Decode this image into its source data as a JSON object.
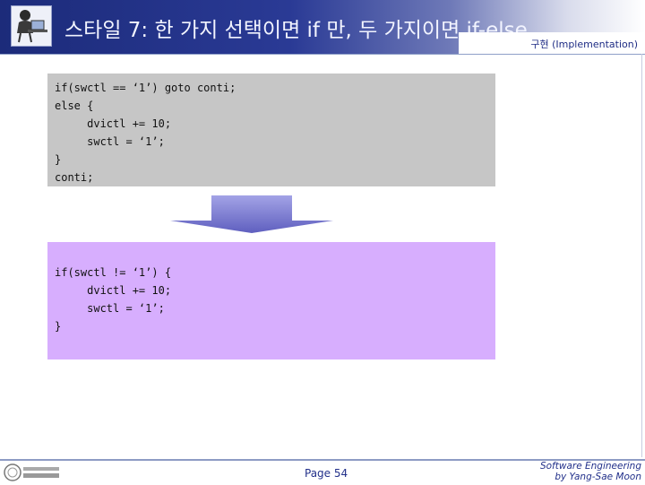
{
  "header": {
    "title": "스타일 7: 한 가지 선택이면 if 만, 두 가지이면 if-else",
    "subtitle": "구현 (Implementation)"
  },
  "code_before": [
    "if(swctl == ‘1’) goto conti;",
    "else {",
    "     dvictl += 10;",
    "     swctl = ‘1’;",
    "}",
    "conti;"
  ],
  "code_after": [
    "if(swctl != ‘1’) {",
    "     dvictl += 10;",
    "     swctl = ‘1’;",
    "}"
  ],
  "footer": {
    "page": "Page 54",
    "credit_line1": "Software Engineering",
    "credit_line2": "by Yang-Sae Moon"
  },
  "colors": {
    "header_blue": "#1c2b7a",
    "code_before_bg": "#c6c6c6",
    "code_after_bg": "#d7aefe",
    "arrow": "#8a8ad6"
  },
  "icons": {
    "header_logo": "person-at-desk-icon",
    "footer_logo": "university-seal-icon"
  }
}
